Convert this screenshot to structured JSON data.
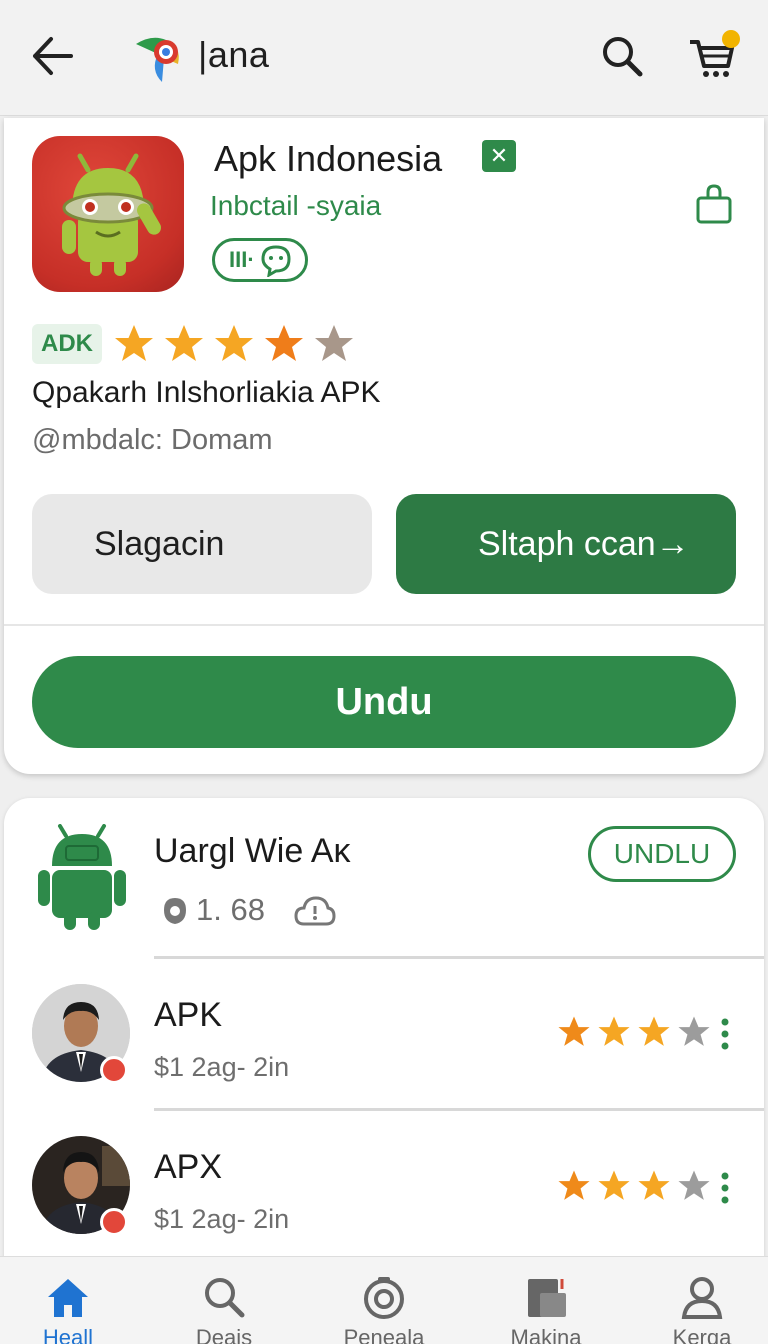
{
  "topbar": {
    "title": "|ana",
    "icons": {
      "back": "arrow-left-icon",
      "logo": "browser-logo-icon",
      "search": "search-icon",
      "cart": "cart-icon"
    },
    "accent": "#f2b400"
  },
  "app": {
    "name": "Apk Indonesia",
    "verified_icon": "✕",
    "developer": "Inbctail -syaia",
    "chip_label": "III·",
    "badge": "ADK",
    "rating_stars": 4,
    "subtitle": "Qpakarh Inlshorliakia APK",
    "meta": "@mbdalc: Domam",
    "secondary_button": "Slagacin",
    "primary_button": "Sltaph ccan→",
    "download_button": "Undu"
  },
  "list": {
    "items": [
      {
        "title": "Uargl Wie Aκ",
        "sub": "1. 68",
        "action": "UNDLU"
      },
      {
        "title": "APK",
        "sub": "$1 2ag- 2in",
        "rating": 3
      },
      {
        "title": "APX",
        "sub": "$1 2ag- 2in",
        "rating": 3
      }
    ]
  },
  "nav": {
    "items": [
      {
        "label": "Heall",
        "icon": "home-icon",
        "active": true
      },
      {
        "label": "Deais",
        "icon": "search-icon"
      },
      {
        "label": "Peneala",
        "icon": "camera-icon"
      },
      {
        "label": "Makina",
        "icon": "folder-icon"
      },
      {
        "label": "Kerqa",
        "icon": "profile-icon"
      }
    ]
  },
  "colors": {
    "primary": "#2f8a4a",
    "primary_dark": "#2d7a44",
    "star": "#f29a1e",
    "star_off": "#9c9c9c",
    "nav_active": "#1f73d1"
  }
}
